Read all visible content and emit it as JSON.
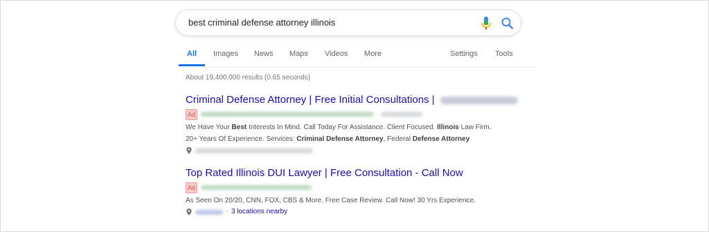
{
  "search": {
    "query": "best criminal defense attorney illinois"
  },
  "icons": {
    "mic": "microphone-icon",
    "search": "search-icon",
    "pin": "location-pin-icon"
  },
  "tabs": {
    "items": [
      {
        "label": "All",
        "active": true
      },
      {
        "label": "Images"
      },
      {
        "label": "News"
      },
      {
        "label": "Maps"
      },
      {
        "label": "Videos"
      },
      {
        "label": "More"
      }
    ],
    "right": [
      {
        "label": "Settings"
      },
      {
        "label": "Tools"
      }
    ]
  },
  "result_stats": "About 19,400,000 results (0.65 seconds)",
  "ads": [
    {
      "title": "Criminal Defense Attorney | Free Initial Consultations |",
      "badge": "Ad",
      "desc_line1_parts": [
        {
          "t": "We Have Your ",
          "b": false
        },
        {
          "t": "Best",
          "b": true
        },
        {
          "t": " Interests In Mind. Call Today For Assistance. Client Focused. ",
          "b": false
        },
        {
          "t": "Illinois",
          "b": true
        },
        {
          "t": " Law Firm.",
          "b": false
        }
      ],
      "desc_line2_parts": [
        {
          "t": "20+ Years Of Experience. Services: ",
          "b": false
        },
        {
          "t": "Criminal Defense Attorney",
          "b": true
        },
        {
          "t": ", Federal ",
          "b": false
        },
        {
          "t": "Defense Attorney",
          "b": true
        }
      ]
    },
    {
      "title": "Top Rated Illinois DUI Lawyer | Free Consultation - Call Now",
      "badge": "Ad",
      "desc_line1": "As Seen On 20/20, CNN, FOX, CBS & More. Free Case Review. Call Now! 30 Yrs Experience.",
      "location_sep": "·",
      "location_link": "3 locations nearby"
    }
  ],
  "colors": {
    "link": "#1a0dab",
    "accent": "#1a73e8",
    "ad_badge_bg": "#f6c9c9"
  }
}
